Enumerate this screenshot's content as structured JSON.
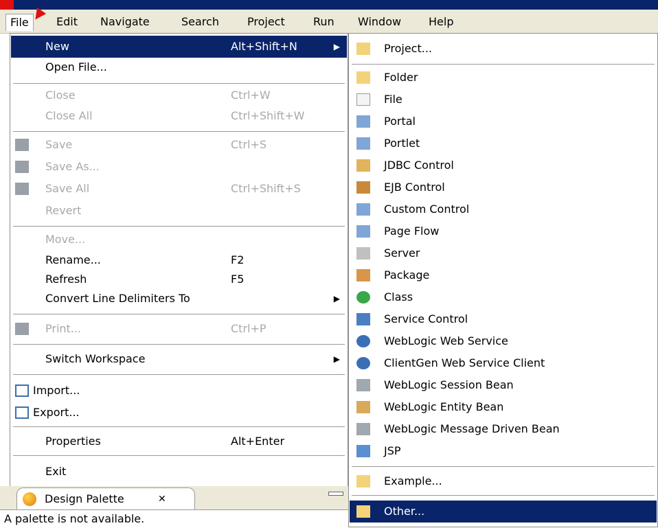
{
  "menubar": {
    "items": [
      "File",
      "Edit",
      "Navigate",
      "Search",
      "Project",
      "Run",
      "Window",
      "Help"
    ]
  },
  "file_menu": {
    "new": {
      "label": "New",
      "shortcut": "Alt+Shift+N"
    },
    "open_file": {
      "label": "Open File..."
    },
    "close": {
      "label": "Close",
      "shortcut": "Ctrl+W"
    },
    "close_all": {
      "label": "Close All",
      "shortcut": "Ctrl+Shift+W"
    },
    "save": {
      "label": "Save",
      "shortcut": "Ctrl+S"
    },
    "save_as": {
      "label": "Save As..."
    },
    "save_all": {
      "label": "Save All",
      "shortcut": "Ctrl+Shift+S"
    },
    "revert": {
      "label": "Revert"
    },
    "move": {
      "label": "Move..."
    },
    "rename": {
      "label": "Rename...",
      "shortcut": "F2"
    },
    "refresh": {
      "label": "Refresh",
      "shortcut": "F5"
    },
    "convert": {
      "label": "Convert Line Delimiters To"
    },
    "print": {
      "label": "Print...",
      "shortcut": "Ctrl+P"
    },
    "switch_workspace": {
      "label": "Switch Workspace"
    },
    "import": {
      "label": "Import..."
    },
    "export": {
      "label": "Export..."
    },
    "properties": {
      "label": "Properties",
      "shortcut": "Alt+Enter"
    },
    "exit": {
      "label": "Exit"
    }
  },
  "new_submenu": {
    "items": [
      "Project...",
      "Folder",
      "File",
      "Portal",
      "Portlet",
      "JDBC Control",
      "EJB Control",
      "Custom Control",
      "Page Flow",
      "Server",
      "Package",
      "Class",
      "Service Control",
      "WebLogic Web Service",
      "ClientGen Web Service Client",
      "WebLogic Session Bean",
      "WebLogic Entity Bean",
      "WebLogic Message Driven Bean",
      "JSP",
      "Example...",
      "Other..."
    ]
  },
  "palette": {
    "tab_label": "Design Palette",
    "close_glyph": "✕",
    "message": "A palette is not available."
  },
  "colors": {
    "highlight": "#0a246a",
    "menubar_bg": "#ece9d8",
    "disabled_text": "#a9a9a9"
  }
}
